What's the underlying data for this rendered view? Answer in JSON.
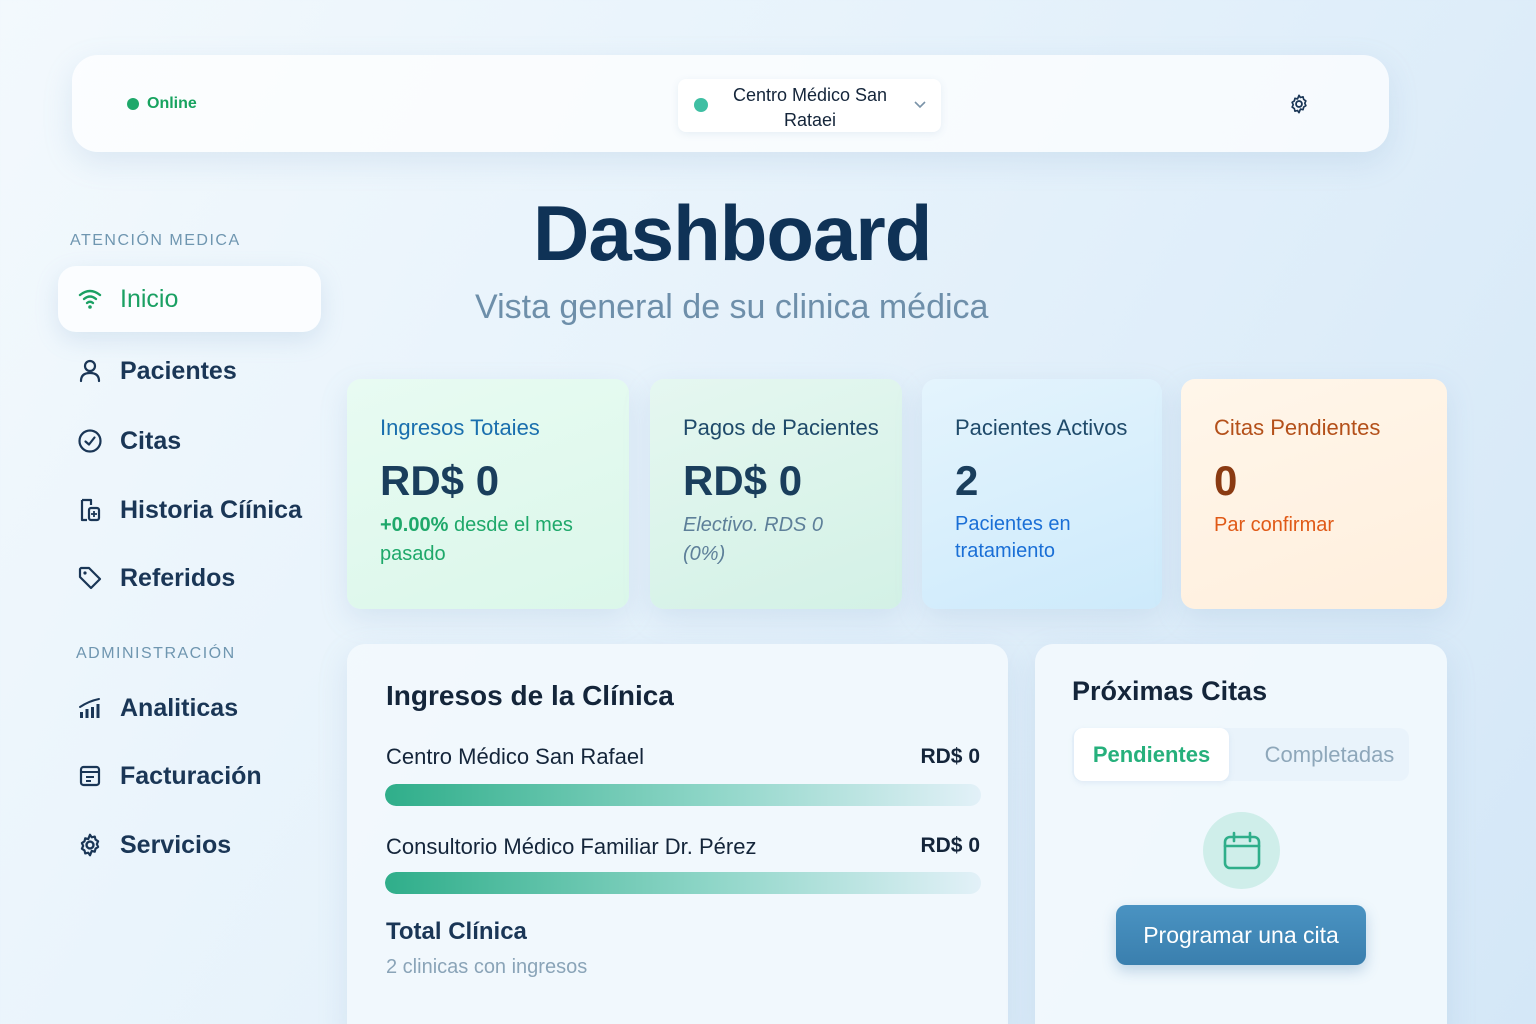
{
  "topbar": {
    "status_label": "Online",
    "clinic_selector": "Centro Médico San Rataei"
  },
  "sidebar": {
    "section_medical": "ATENCIÓN  MEDICA",
    "section_admin": "ADMINISTRACIÓN",
    "items_medical": [
      {
        "label": "Inicio",
        "icon": "wifi-icon",
        "active": true
      },
      {
        "label": "Pacientes",
        "icon": "user-icon"
      },
      {
        "label": "Citas",
        "icon": "check-circle-icon"
      },
      {
        "label": "Historia Cíínica",
        "icon": "medical-record-icon"
      },
      {
        "label": "Referidos",
        "icon": "tag-icon"
      }
    ],
    "items_admin": [
      {
        "label": "Analiticas",
        "icon": "bar-chart-icon"
      },
      {
        "label": "Facturación",
        "icon": "invoice-icon"
      },
      {
        "label": "Servicios",
        "icon": "gear-icon"
      }
    ]
  },
  "header": {
    "title": "Dashboard",
    "subtitle": "Vista general de su clinica médica"
  },
  "stats": [
    {
      "title": "Ingresos Totaies",
      "value": "RD$ 0",
      "note_highlight": "+0.00%",
      "note": " desde el mes pasado",
      "color": "#1a6fae"
    },
    {
      "title": "Pagos de Pacientes",
      "value": "RD$ 0",
      "note": "Electivo. RDS 0 (0%)",
      "color": "#1f4a6a"
    },
    {
      "title": "Pacientes Activos",
      "value": "2",
      "note": "Pacientes en tratamiento",
      "color": "#1f4a6a"
    },
    {
      "title": "Citas Pendientes",
      "value": "0",
      "note": "Par confirmar",
      "color": "#b4501a"
    }
  ],
  "income": {
    "title": "Ingresos de la Clínica",
    "rows": [
      {
        "label": "Centro Médico San Rafael",
        "value": "RD$ 0",
        "progress": 1.0
      },
      {
        "label": "Consultorio Médico Familiar Dr. Pérez",
        "value": "RD$ 0",
        "progress": 1.0
      }
    ],
    "total_label": "Total Clínica",
    "total_note": "2 clinicas con ingresos"
  },
  "upcoming": {
    "title": "Próximas Citas",
    "tabs": [
      "Pendientes",
      "Completadas"
    ],
    "active_tab": "Pendientes",
    "empty_icon": "calendar-icon",
    "cta_label": "Programar una cita"
  },
  "colors": {
    "accent_green": "#1aa063",
    "primary_navy": "#0f3256",
    "button_blue": "#3a7fae"
  }
}
